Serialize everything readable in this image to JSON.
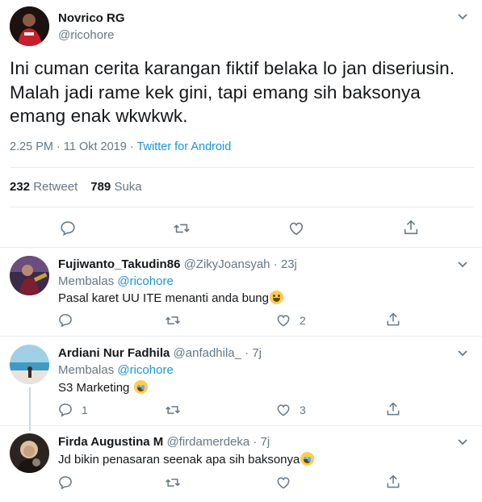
{
  "main_tweet": {
    "author_name": "Novrico RG",
    "author_handle": "@ricohore",
    "text_lines": [
      "Ini cuman cerita karangan fiktif belaka lo jan diseriusin.",
      "Malah jadi rame kek gini, tapi emang sih baksonya",
      "emang enak wkwkwk."
    ],
    "time": "2.25 PM",
    "separator": " · ",
    "date": "11 Okt 2019",
    "client": "Twitter for Android",
    "retweet_count": "232",
    "retweet_label": "Retweet",
    "like_count": "789",
    "like_label": "Suka"
  },
  "replies": [
    {
      "name": "Fujiwanto_Takudin86",
      "handle": "@ZikyJoansyah",
      "time": "· 23j",
      "reply_label": "Membalas",
      "reply_to": "@ricohore",
      "text": "Pasal karet UU ITE menanti anda bung",
      "emoji": "grinning-face",
      "reply_count": "",
      "like_count": "2"
    },
    {
      "name": "Ardiani Nur Fadhila",
      "handle": "@anfadhila_",
      "time": "· 7j",
      "reply_label": "Membalas",
      "reply_to": "@ricohore",
      "text": "S3 Marketing",
      "emoji": "tears-of-joy-face",
      "reply_count": "1",
      "like_count": "3"
    },
    {
      "name": "Firda Augustina M",
      "handle": "@firdamerdeka",
      "time": "· 7j",
      "text": "Jd bikin penasaran seenak apa sih baksonya",
      "emoji": "tears-of-joy-face",
      "reply_count": "",
      "like_count": ""
    }
  ],
  "icons": {
    "reply": "comment-bubble-icon",
    "retweet": "retweet-arrows-icon",
    "like": "heart-outline-icon",
    "share": "share-upload-icon",
    "more": "chevron-down-icon"
  },
  "colors": {
    "text": "#14171a",
    "secondary": "#657786",
    "link": "#1b95e0",
    "divider": "#e6ecf0"
  }
}
